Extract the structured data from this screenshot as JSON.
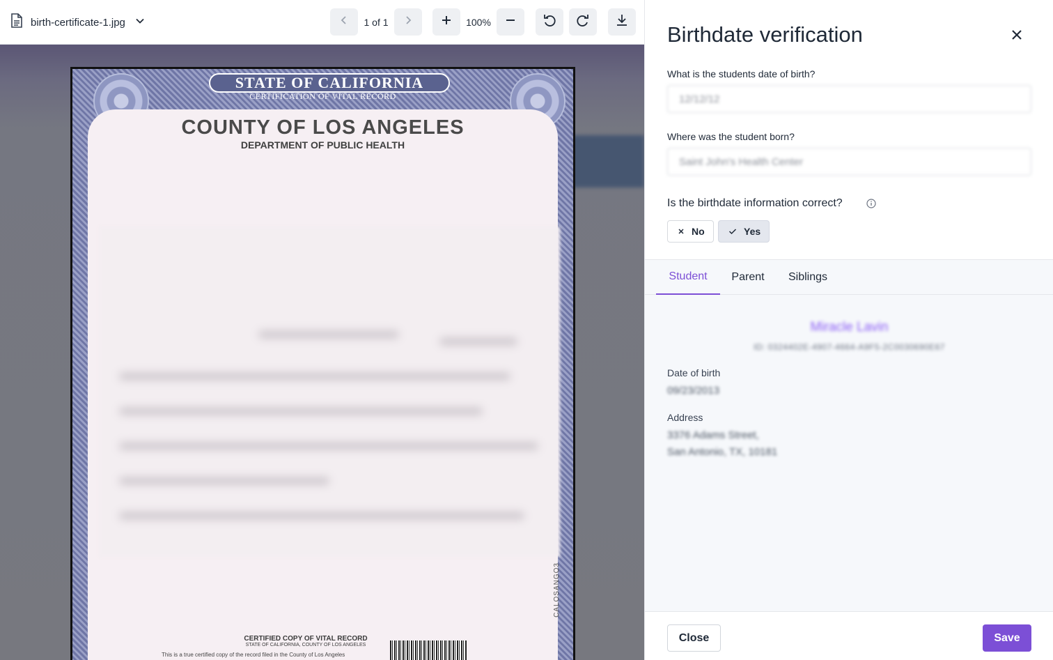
{
  "viewer": {
    "file_name": "birth-certificate-1.jpg",
    "page_indicator": "1 of 1",
    "zoom": "100%",
    "document": {
      "state_banner": "STATE OF CALIFORNIA",
      "banner_sub": "CERTIFICATION OF VITAL RECORD",
      "county": "COUNTY OF LOS ANGELES",
      "department": "DEPARTMENT OF PUBLIC HEALTH",
      "side_code": "CALOSANGO3",
      "certified": "CERTIFIED COPY OF VITAL RECORD",
      "certified_sub": "STATE OF CALIFORNIA, COUNTY OF LOS ANGELES",
      "footnote": "This is a true certified copy of the record filed in the County of Los Angeles"
    }
  },
  "panel": {
    "title": "Birthdate verification",
    "q1": {
      "label": "What is the students date of birth?",
      "value": "12/12/12"
    },
    "q2": {
      "label": "Where was the student born?",
      "value": "Saint John's Health Center"
    },
    "q3": {
      "label": "Is the birthdate information correct?",
      "no": "No",
      "yes": "Yes",
      "selected": "yes"
    },
    "tabs": [
      "Student",
      "Parent",
      "Siblings"
    ],
    "active_tab": "Student",
    "student": {
      "name": "Miracle Lavin",
      "id": "ID: 0324402E-4907-4664-A9F5-2C0030690E67",
      "dob_label": "Date of birth",
      "dob_value": "09/23/2013",
      "address_label": "Address",
      "address_line1": "3376 Adams Street,",
      "address_line2": "San Antonio, TX, 10181"
    },
    "footer": {
      "close": "Close",
      "save": "Save"
    }
  },
  "colors": {
    "accent": "#7c4fd6",
    "tab_active": "#7c4fd6"
  }
}
